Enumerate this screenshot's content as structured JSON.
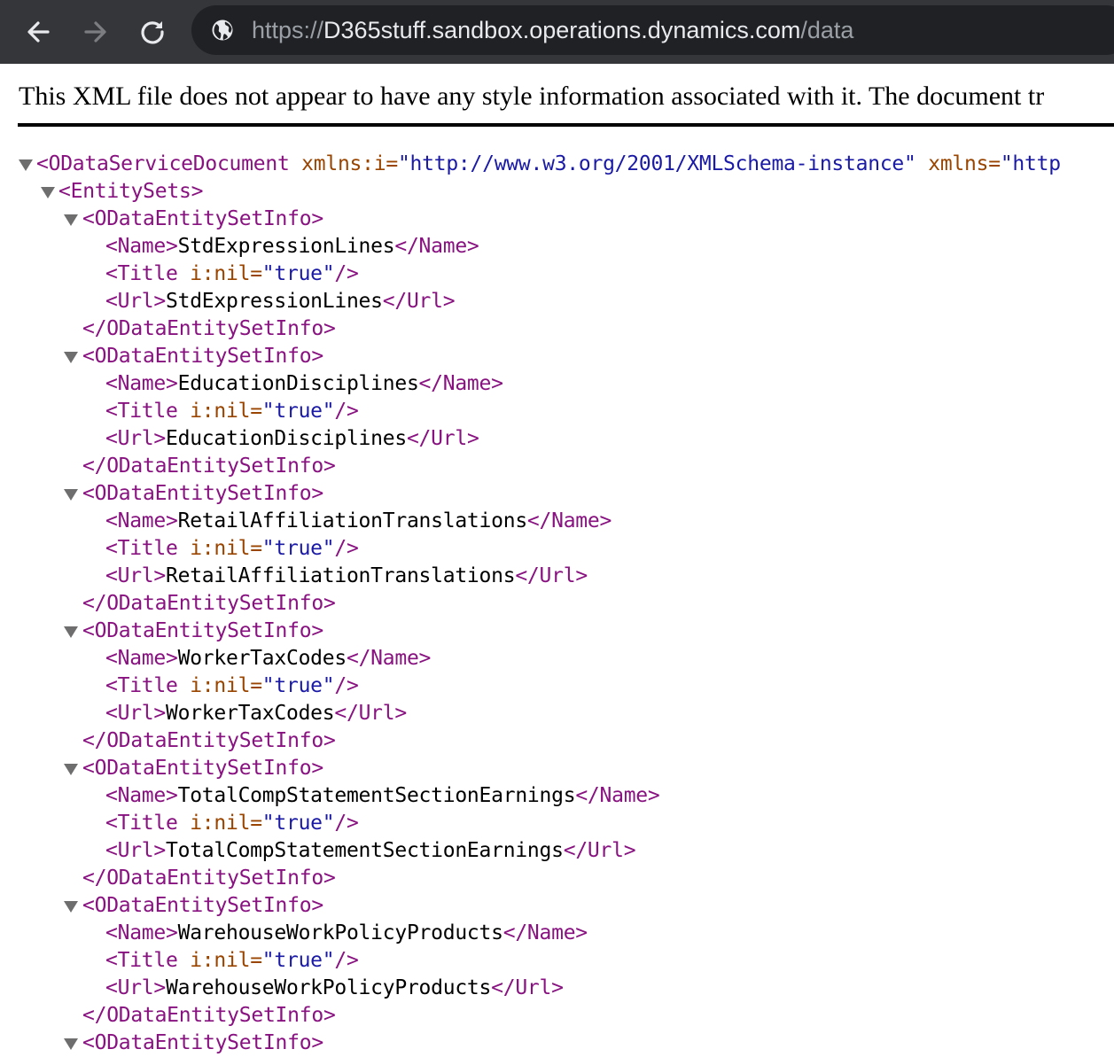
{
  "browser": {
    "url_scheme": "https://",
    "url_host": "D365stuff.sandbox.operations.dynamics.com",
    "url_path": "/data"
  },
  "info_text": "This XML file does not appear to have any style information associated with it. The document tr",
  "xml": {
    "root_open": "<ODataServiceDocument",
    "root_attr1_name": "xmlns:i=",
    "root_attr1_value": "\"http://www.w3.org/2001/XMLSchema-instance\"",
    "root_attr2_name": "xmlns=",
    "root_attr2_value": "\"http",
    "entitysets_open": "<EntitySets>",
    "info_open": "<ODataEntitySetInfo>",
    "info_close": "</ODataEntitySetInfo>",
    "name_open": "<Name>",
    "name_close": "</Name>",
    "title_open": "<Title",
    "title_attr": "i:nil=",
    "title_value": "\"true\"",
    "title_close": "/>",
    "url_open": "<Url>",
    "url_close": "</Url>",
    "entities": [
      {
        "name": "StdExpressionLines",
        "url": "StdExpressionLines"
      },
      {
        "name": "EducationDisciplines",
        "url": "EducationDisciplines"
      },
      {
        "name": "RetailAffiliationTranslations",
        "url": "RetailAffiliationTranslations"
      },
      {
        "name": "WorkerTaxCodes",
        "url": "WorkerTaxCodes"
      },
      {
        "name": "TotalCompStatementSectionEarnings",
        "url": "TotalCompStatementSectionEarnings"
      },
      {
        "name": "WarehouseWorkPolicyProducts",
        "url": "WarehouseWorkPolicyProducts"
      }
    ],
    "partial_line": "<ODataEntitySetInfo>"
  }
}
